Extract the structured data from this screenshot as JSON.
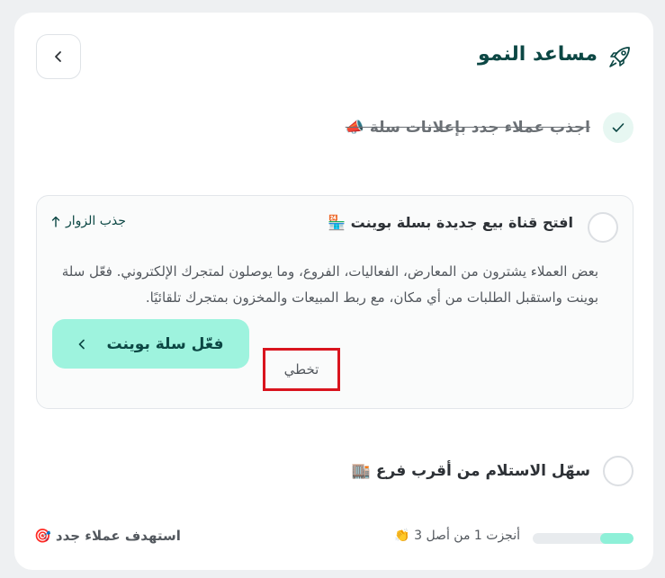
{
  "header": {
    "title": "مساعد النمو",
    "back_icon": "chevron-left-icon",
    "title_icon": "rocket-icon"
  },
  "tasks": {
    "done": {
      "label": "اجذب عملاء جدد بإعلانات سلة 📣",
      "status": "completed"
    },
    "active": {
      "title": "افتح قناة بيع جديدة بسلة بوينت 🏪",
      "category": "جذب الزوار",
      "category_icon": "arrow-up-icon",
      "description": "بعض العملاء يشترون من المعارض، الفعاليات، الفروع، وما يوصلون لمتجرك الإلكتروني. فعّل سلة بوينت واستقبل الطلبات من أي مكان، مع ربط المبيعات والمخزون بمتجرك تلقائيًا.",
      "cta_label": "فعّل سلة بوينت",
      "skip_label": "تخطي"
    },
    "next": {
      "label": "سهّل الاستلام من أقرب فرع 🏬"
    }
  },
  "footer": {
    "progress_text": "أنجزت 1 من أصل 3 👏",
    "progress_fraction": 0.33,
    "goal_label": "استهدف عملاء جدد 🎯"
  },
  "colors": {
    "accent": "#9ef3de",
    "brand_dark": "#0c4744",
    "highlight_border": "#d9141e"
  }
}
